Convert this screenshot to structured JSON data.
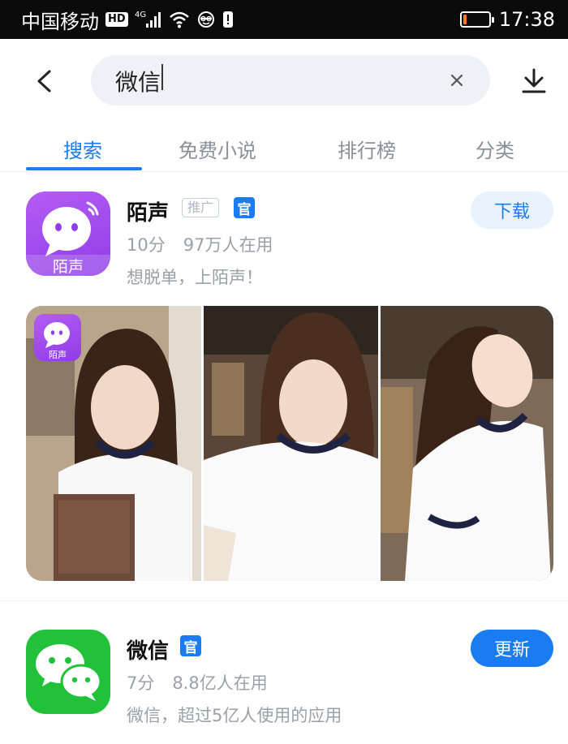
{
  "status_bar": {
    "carrier": "中国移动",
    "hd": "HD",
    "network": "4G",
    "time": "17:38",
    "battery_level": 0.15,
    "battery_color": "#ff7a2a"
  },
  "search": {
    "query": "微信",
    "back_icon": "chevron-left-icon",
    "clear_icon": "close-icon",
    "download_icon": "download-icon"
  },
  "tabs": [
    {
      "label": "搜索",
      "active": true
    },
    {
      "label": "免费小说",
      "active": false
    },
    {
      "label": "排行榜",
      "active": false
    },
    {
      "label": "分类",
      "active": false
    }
  ],
  "results": [
    {
      "name": "陌声",
      "promo_tag": "推广",
      "official_badge": "官",
      "rating": "10分",
      "users": "97万人在用",
      "description": "想脱单，上陌声！",
      "action": "下载",
      "icon_label": "陌声",
      "icon_color": "#a44cf0"
    },
    {
      "name": "微信",
      "official_badge": "官",
      "rating": "7分",
      "users": "8.8亿人在用",
      "description": "微信，超过5亿人使用的应用",
      "action": "更新",
      "icon_color": "#22c13a"
    }
  ],
  "banner": {
    "overlay_icon_label": "陌声"
  },
  "colors": {
    "accent": "#1a7cf0",
    "muted_text": "#9aa0a8"
  }
}
